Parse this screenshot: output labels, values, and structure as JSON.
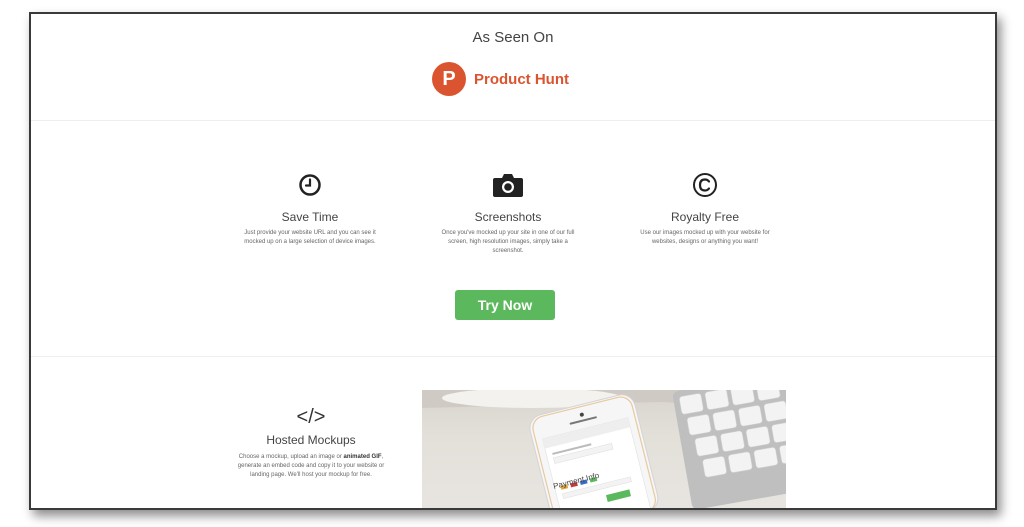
{
  "seen_on": {
    "title": "As Seen On",
    "logo_letter": "P",
    "logo_name": "Product Hunt",
    "brand_color": "#da552f"
  },
  "features": [
    {
      "icon": "clock-icon",
      "title": "Save Time",
      "desc": "Just provide your website URL and you can see it mocked up on a large selection of device images."
    },
    {
      "icon": "camera-icon",
      "title": "Screenshots",
      "desc": "Once you've mocked up your site in one of our full screen, high resolution images, simply take a screenshot."
    },
    {
      "icon": "copyright-icon",
      "title": "Royalty Free",
      "desc": "Use our images mocked up with your website for websites, designs or anything you want!"
    }
  ],
  "cta": {
    "label": "Try Now",
    "color": "#5cb85c"
  },
  "hosted": {
    "icon": "code-icon",
    "icon_glyph": "</>",
    "title": "Hosted Mockups",
    "desc_pre": "Choose a mockup, upload an image or ",
    "desc_bold": "animated GIF",
    "desc_post": ", generate an embed code and copy it to your website or landing page. We'll host your mockup for free."
  },
  "photo": {
    "phone_text": "Payment Info"
  }
}
